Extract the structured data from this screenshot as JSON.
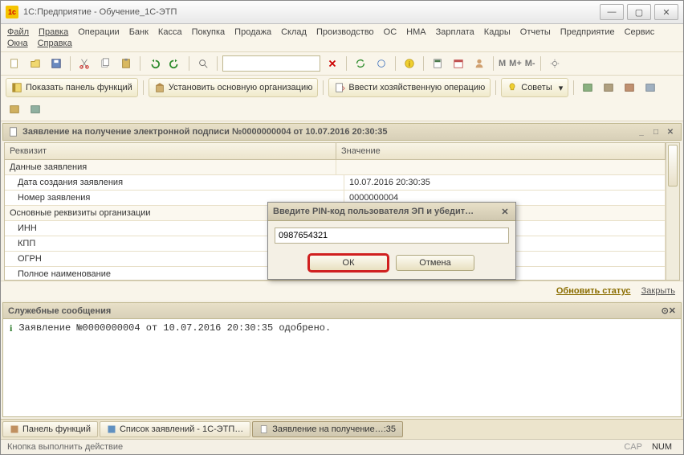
{
  "window": {
    "title": "1С:Предприятие - Обучение_1С-ЭТП"
  },
  "menu": [
    "Файл",
    "Правка",
    "Операции",
    "Банк",
    "Касса",
    "Покупка",
    "Продажа",
    "Склад",
    "Производство",
    "ОС",
    "НМА",
    "Зарплата",
    "Кадры",
    "Отчеты",
    "Предприятие",
    "Сервис",
    "Окна",
    "Справка"
  ],
  "toolbar2": {
    "show_panel": "Показать панель функций",
    "set_org": "Установить основную организацию",
    "enter_op": "Ввести хозяйственную операцию",
    "tips": "Советы"
  },
  "doc": {
    "title": "Заявление на получение электронной подписи №0000000004 от 10.07.2016 20:30:35",
    "columns": {
      "attr": "Реквизит",
      "val": "Значение"
    },
    "rows": [
      {
        "attr": "Данные заявления",
        "val": "",
        "group": true
      },
      {
        "attr": "Дата создания заявления",
        "val": "10.07.2016 20:30:35"
      },
      {
        "attr": "Номер заявления",
        "val": "0000000004"
      },
      {
        "attr": "Основные реквизиты организации",
        "val": "",
        "group": true
      },
      {
        "attr": "ИНН",
        "val": ""
      },
      {
        "attr": "КПП",
        "val": ""
      },
      {
        "attr": "ОГРН",
        "val": ""
      },
      {
        "attr": "Полное наименование",
        "val": ""
      }
    ]
  },
  "actions": {
    "refresh": "Обновить статус",
    "close": "Закрыть"
  },
  "messages": {
    "title": "Служебные сообщения",
    "text": "Заявление №0000000004 от 10.07.2016 20:30:35 одобрено."
  },
  "modal": {
    "title": "Введите PIN-код пользователя ЭП и убедит…",
    "value": "0987654321",
    "ok": "ОК",
    "cancel": "Отмена"
  },
  "tasks": [
    {
      "label": "Панель функций"
    },
    {
      "label": "Список заявлений - 1С-ЭТП…"
    },
    {
      "label": "Заявление на получение…:35",
      "active": true
    }
  ],
  "status": {
    "hint": "Кнопка выполнить действие",
    "cap": "CAP",
    "num": "NUM"
  },
  "mtext": {
    "m": "M",
    "mp": "M+",
    "mm": "M-"
  }
}
